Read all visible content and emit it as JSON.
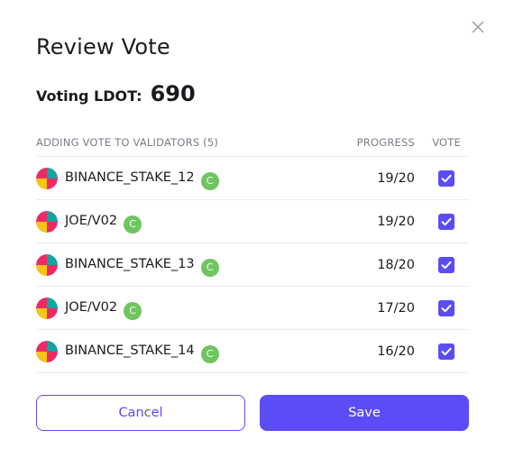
{
  "dialog": {
    "title": "Review Vote",
    "voting_label": "Voting LDOT:",
    "voting_value": "690"
  },
  "table": {
    "headers": {
      "name": "ADDING VOTE TO VALIDATORS (5)",
      "progress": "PROGRESS",
      "vote": "VOTE"
    },
    "rows": [
      {
        "name": "BINANCE_STAKE_12",
        "badge": "C",
        "progress": "19/20",
        "vote_checked": true
      },
      {
        "name": "JOE/V02",
        "badge": "C",
        "progress": "19/20",
        "vote_checked": true
      },
      {
        "name": "BINANCE_STAKE_13",
        "badge": "C",
        "progress": "18/20",
        "vote_checked": true
      },
      {
        "name": "JOE/V02",
        "badge": "C",
        "progress": "17/20",
        "vote_checked": true
      },
      {
        "name": "BINANCE_STAKE_14",
        "badge": "C",
        "progress": "16/20",
        "vote_checked": true
      }
    ]
  },
  "actions": {
    "cancel_label": "Cancel",
    "save_label": "Save"
  },
  "colors": {
    "accent": "#5b4cf5",
    "badge": "#6fc55f",
    "avatar_teal": "#14a3a0",
    "avatar_pink": "#ee2a64",
    "avatar_yellow": "#f5c518"
  },
  "icons": {
    "close": "close-icon",
    "avatar": "validator-avatar-icon",
    "check": "checkbox-check-icon"
  }
}
